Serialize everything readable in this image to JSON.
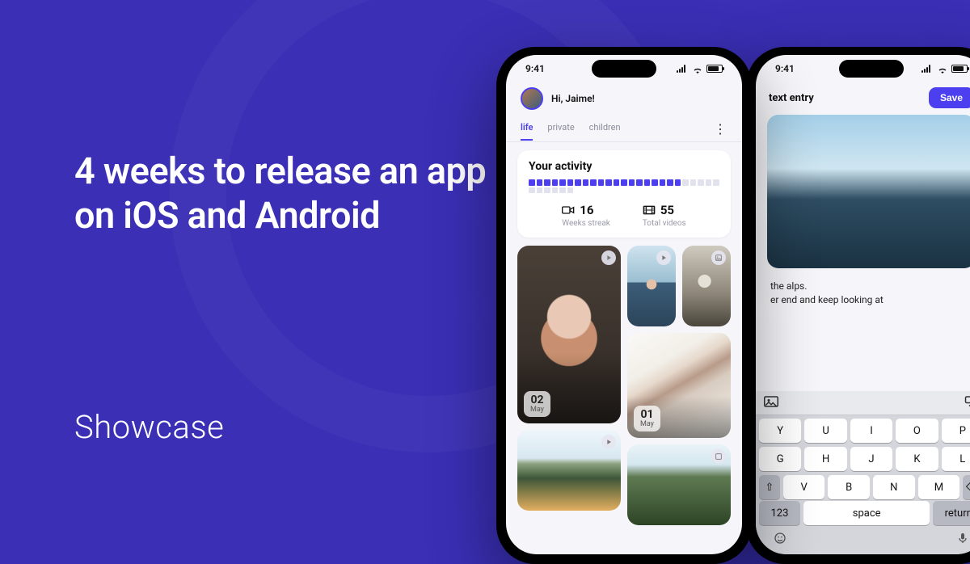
{
  "marketing": {
    "headline": "4 weeks to release an app on iOS and Android",
    "footer": "Showcase"
  },
  "phone_front": {
    "status_time": "9:41",
    "greeting": "Hi, Jaime!",
    "tabs": [
      "life",
      "private",
      "children"
    ],
    "active_tab_index": 0,
    "more_icon": "more-vertical-icon",
    "activity": {
      "title": "Your activity",
      "filled_days": 20,
      "total_days": 31,
      "weeks_streak": {
        "value": "16",
        "label": "Weeks streak"
      },
      "total_videos": {
        "value": "55",
        "label": "Total videos"
      }
    },
    "gallery": [
      {
        "type": "portrait-large",
        "date_day": "02",
        "date_month": "May",
        "corner": "play-icon"
      },
      {
        "type": "girl-mountain",
        "corner": "play-icon"
      },
      {
        "type": "cat",
        "corner": "image-icon"
      },
      {
        "type": "laying",
        "date_day": "01",
        "date_month": "May"
      },
      {
        "type": "autumn-mountain",
        "corner": "play-icon"
      },
      {
        "type": "forest",
        "corner": "image-icon"
      }
    ]
  },
  "phone_back": {
    "status_time": "9:41",
    "title": "text entry",
    "save_label": "Save",
    "entry_text_line1": "the alps.",
    "entry_text_line2": "er end and keep looking at",
    "keyboard": {
      "row1": [
        "Y",
        "U",
        "I",
        "O",
        "P"
      ],
      "row2": [
        "G",
        "H",
        "J",
        "K",
        "L"
      ],
      "row3_left": "⇧",
      "row3": [
        "V",
        "B",
        "N",
        "M"
      ],
      "row3_right": "⌫",
      "bottom": {
        "numbers": "123",
        "space": "space",
        "ret": "return"
      }
    }
  }
}
